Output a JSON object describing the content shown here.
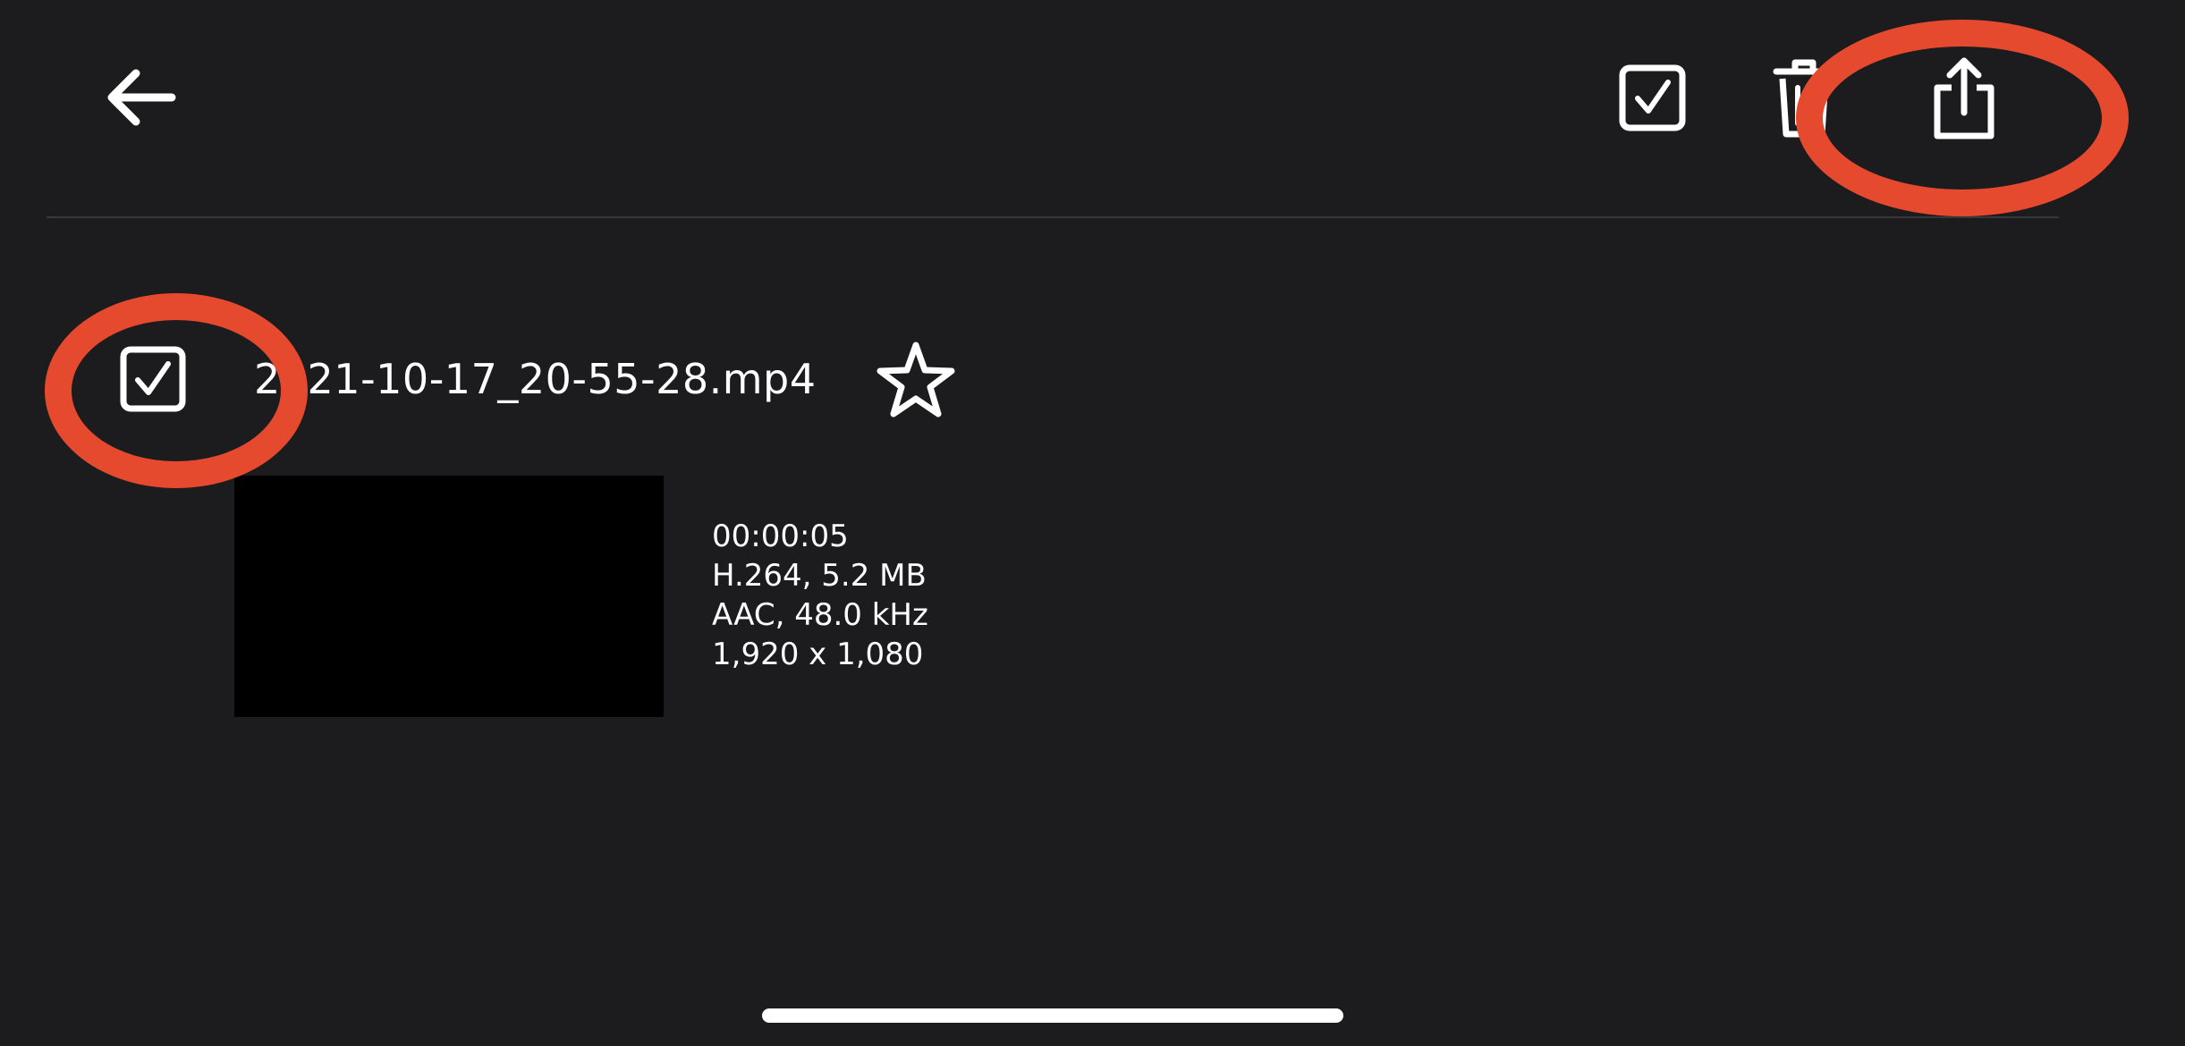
{
  "toolbar": {
    "back_icon": "arrow-left-icon",
    "select_all_icon": "checkbox-checked-icon",
    "delete_icon": "trash-icon",
    "share_icon": "share-icon"
  },
  "file": {
    "name": "2021-10-17_20-55-28.mp4",
    "selected": true,
    "favorite_icon": "star-outline-icon",
    "duration": "00:00:05",
    "video_info": "H.264, 5.2 MB",
    "audio_info": "AAC, 48.0 kHz",
    "resolution": "1,920 x 1,080"
  },
  "annotations": {
    "color": "#e64a2e",
    "targets": [
      "share-button",
      "item-checkbox"
    ]
  },
  "colors": {
    "background": "#1c1c1e",
    "foreground": "#ffffff",
    "divider": "#38383b"
  }
}
